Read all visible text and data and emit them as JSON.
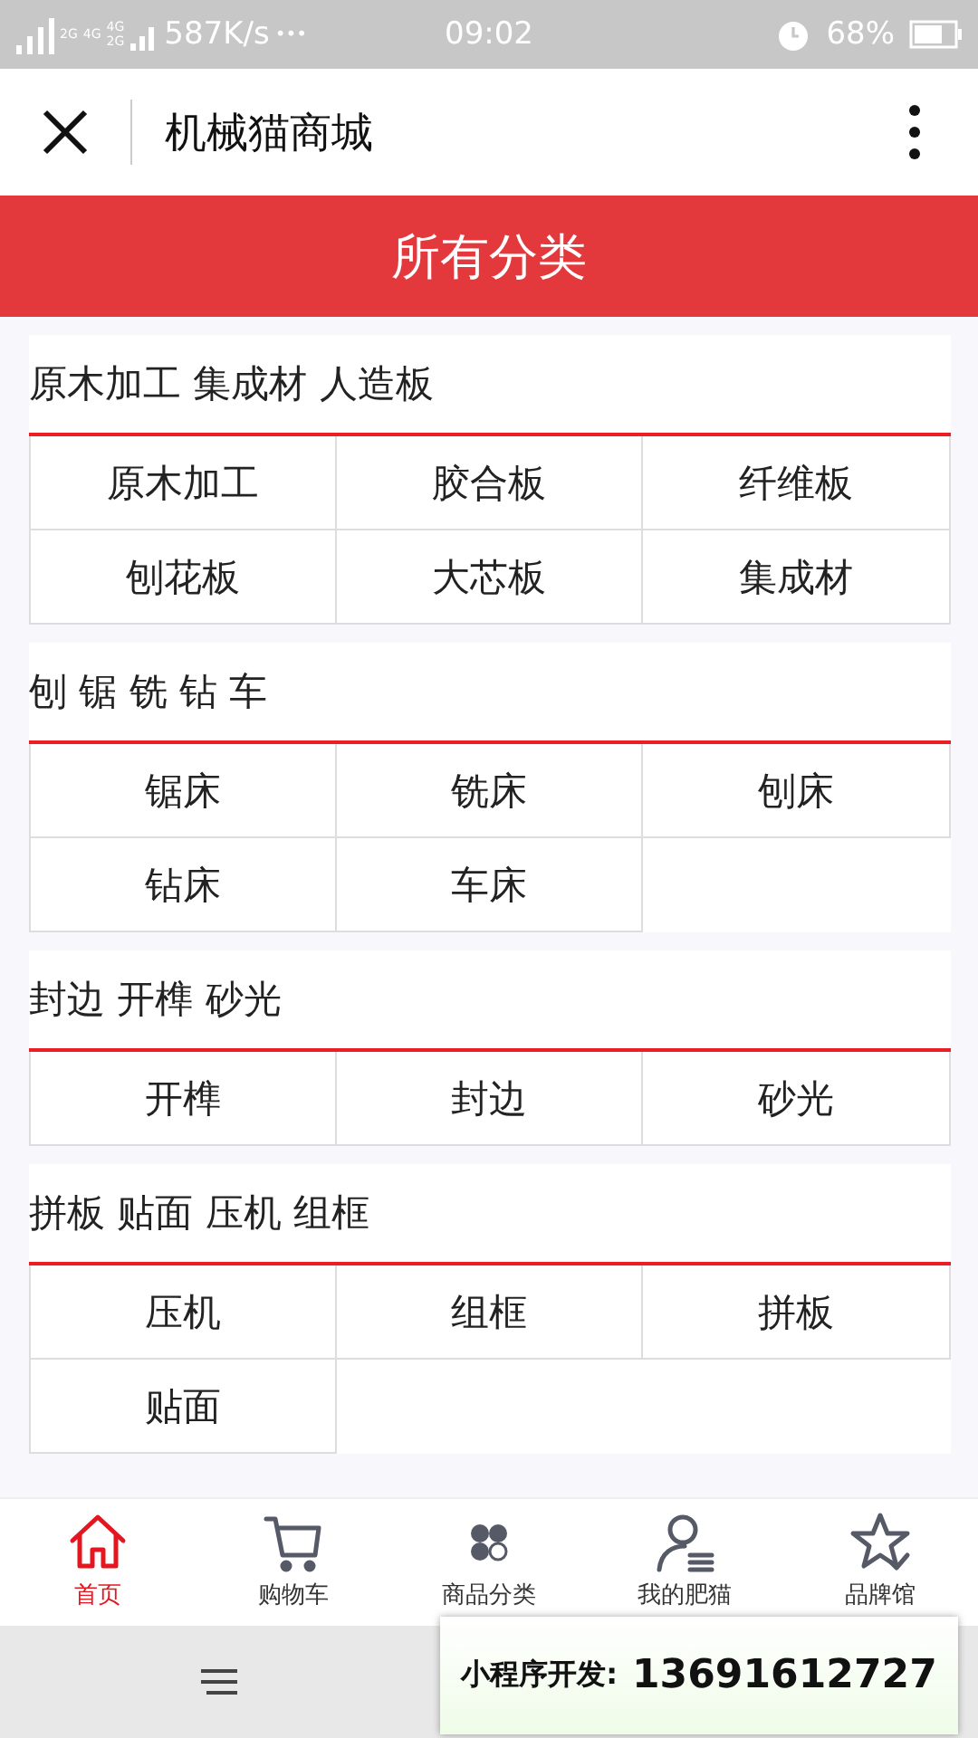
{
  "status_bar": {
    "network_labels": [
      "2G",
      "4G",
      "4G",
      "2G"
    ],
    "speed": "587K/s",
    "dots": "•••",
    "time": "09:02",
    "battery": "68%"
  },
  "nav": {
    "title": "机械猫商城"
  },
  "header": {
    "title": "所有分类"
  },
  "sections": [
    {
      "title": "原木加工 集成材 人造板",
      "items": [
        "原木加工",
        "胶合板",
        "纤维板",
        "刨花板",
        "大芯板",
        "集成材"
      ]
    },
    {
      "title": "刨 锯 铣 钻 车",
      "items": [
        "锯床",
        "铣床",
        "刨床",
        "钻床",
        "车床"
      ]
    },
    {
      "title": "封边 开榫 砂光",
      "items": [
        "开榫",
        "封边",
        "砂光"
      ]
    },
    {
      "title": "拼板 贴面 压机 组框",
      "items": [
        "压机",
        "组框",
        "拼板",
        "贴面"
      ]
    }
  ],
  "tabs": [
    {
      "kind": "home",
      "label": "首页",
      "selected": true
    },
    {
      "kind": "cart",
      "label": "购物车",
      "selected": false
    },
    {
      "kind": "category",
      "label": "商品分类",
      "selected": false
    },
    {
      "kind": "user",
      "label": "我的肥猫",
      "selected": false
    },
    {
      "kind": "brand",
      "label": "品牌馆",
      "selected": false
    }
  ],
  "overlay": {
    "label": "小程序开发:",
    "phone": "13691612727"
  }
}
